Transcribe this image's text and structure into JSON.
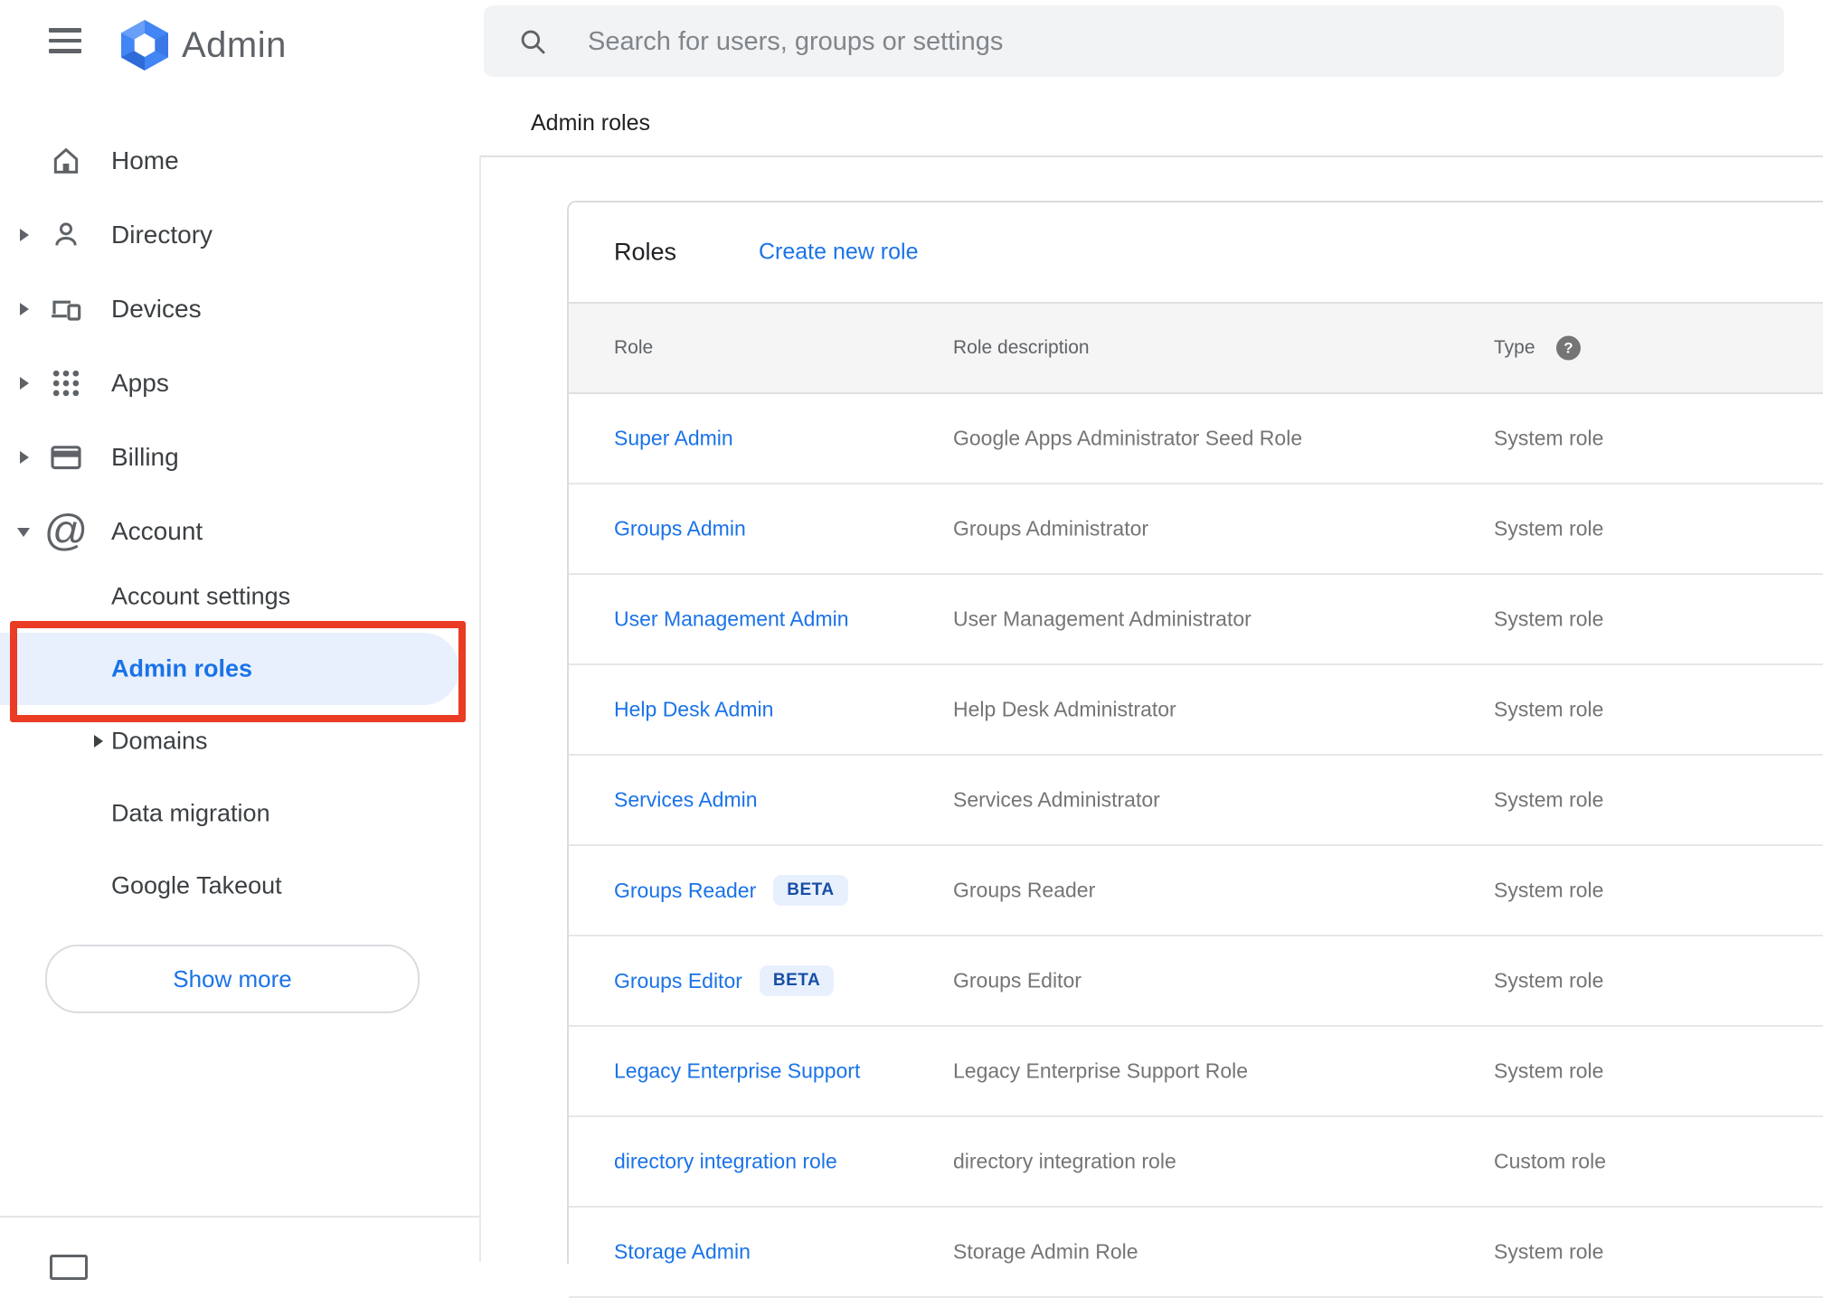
{
  "app": {
    "title": "Admin"
  },
  "search": {
    "placeholder": "Search for users, groups or settings"
  },
  "breadcrumb": {
    "label": "Admin roles"
  },
  "sidebar": {
    "items": [
      {
        "label": "Home",
        "icon": "home-icon",
        "arrow": "none"
      },
      {
        "label": "Directory",
        "icon": "directory-icon",
        "arrow": "right"
      },
      {
        "label": "Devices",
        "icon": "devices-icon",
        "arrow": "right"
      },
      {
        "label": "Apps",
        "icon": "apps-icon",
        "arrow": "right"
      },
      {
        "label": "Billing",
        "icon": "billing-icon",
        "arrow": "right"
      },
      {
        "label": "Account",
        "icon": "account-icon",
        "arrow": "down"
      }
    ],
    "account_subitems": [
      {
        "label": "Account settings",
        "selected": false,
        "arrow": "none"
      },
      {
        "label": "Admin roles",
        "selected": true,
        "arrow": "none"
      },
      {
        "label": "Domains",
        "selected": false,
        "arrow": "right"
      },
      {
        "label": "Data migration",
        "selected": false,
        "arrow": "none"
      },
      {
        "label": "Google Takeout",
        "selected": false,
        "arrow": "none"
      }
    ],
    "show_more_label": "Show more"
  },
  "panel": {
    "title": "Roles",
    "create_link": "Create new role",
    "beta_label": "BETA",
    "columns": {
      "role": "Role",
      "description": "Role description",
      "type": "Type"
    },
    "rows": [
      {
        "role": "Super Admin",
        "beta": false,
        "description": "Google Apps Administrator Seed Role",
        "type": "System role"
      },
      {
        "role": "Groups Admin",
        "beta": false,
        "description": "Groups Administrator",
        "type": "System role"
      },
      {
        "role": "User Management Admin",
        "beta": false,
        "description": "User Management Administrator",
        "type": "System role"
      },
      {
        "role": "Help Desk Admin",
        "beta": false,
        "description": "Help Desk Administrator",
        "type": "System role"
      },
      {
        "role": "Services Admin",
        "beta": false,
        "description": "Services Administrator",
        "type": "System role"
      },
      {
        "role": "Groups Reader",
        "beta": true,
        "description": "Groups Reader",
        "type": "System role"
      },
      {
        "role": "Groups Editor",
        "beta": true,
        "description": "Groups Editor",
        "type": "System role"
      },
      {
        "role": "Legacy Enterprise Support",
        "beta": false,
        "description": "Legacy Enterprise Support Role",
        "type": "System role"
      },
      {
        "role": "directory integration role",
        "beta": false,
        "description": "directory integration role",
        "type": "Custom role"
      },
      {
        "role": "Storage Admin",
        "beta": false,
        "description": "Storage Admin Role",
        "type": "System role"
      }
    ]
  },
  "colors": {
    "accent": "#1a73e8",
    "selected_bg": "#e8f0fe",
    "annotation_red": "#ea3b24",
    "beta_bg": "#e8f0fe",
    "beta_text": "#174ea6",
    "search_bg": "#f1f3f4",
    "header_band_bg": "#f5f5f5",
    "text_primary": "#202124",
    "text_secondary": "#5f6368",
    "text_muted": "#757575"
  }
}
